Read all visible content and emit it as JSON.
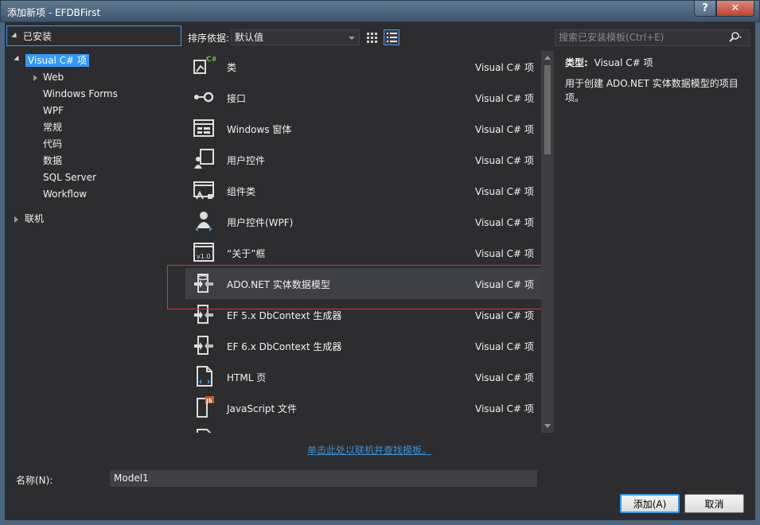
{
  "window": {
    "title": "添加新项 - EFDBFirst",
    "help_glyph": "?",
    "close_glyph": "✕"
  },
  "tree": {
    "header": "已安装",
    "items": [
      {
        "label": "Visual C# 项",
        "level": 0,
        "expanded": true,
        "selected": true
      },
      {
        "label": "Web",
        "level": 1,
        "collapsed": true
      },
      {
        "label": "Windows Forms",
        "level": 1
      },
      {
        "label": "WPF",
        "level": 1
      },
      {
        "label": "常规",
        "level": 1
      },
      {
        "label": "代码",
        "level": 1
      },
      {
        "label": "数据",
        "level": 1
      },
      {
        "label": "SQL Server",
        "level": 1
      },
      {
        "label": "Workflow",
        "level": 1
      }
    ],
    "online": "联机"
  },
  "toolbar": {
    "sort_label": "排序依据:",
    "sort_value": "默认值",
    "search_placeholder": "搜索已安装模板(Ctrl+E)"
  },
  "templates": [
    {
      "name": "类",
      "category": "Visual C# 项",
      "icon": "class-icon"
    },
    {
      "name": "接口",
      "category": "Visual C# 项",
      "icon": "interface-icon"
    },
    {
      "name": "Windows 窗体",
      "category": "Visual C# 项",
      "icon": "windows-form-icon"
    },
    {
      "name": "用户控件",
      "category": "Visual C# 项",
      "icon": "user-control-icon"
    },
    {
      "name": "组件类",
      "category": "Visual C# 项",
      "icon": "component-class-icon"
    },
    {
      "name": "用户控件(WPF)",
      "category": "Visual C# 项",
      "icon": "wpf-user-control-icon"
    },
    {
      "name": "“关于”框",
      "category": "Visual C# 项",
      "icon": "about-box-icon"
    },
    {
      "name": "ADO.NET 实体数据模型",
      "category": "Visual C# 项",
      "icon": "entity-model-icon",
      "selected": true
    },
    {
      "name": "EF 5.x DbContext 生成器",
      "category": "Visual C# 项",
      "icon": "ef-generator-icon"
    },
    {
      "name": "EF 6.x DbContext 生成器",
      "category": "Visual C# 项",
      "icon": "ef-generator-icon"
    },
    {
      "name": "HTML 页",
      "category": "Visual C# 项",
      "icon": "html-page-icon"
    },
    {
      "name": "JavaScript 文件",
      "category": "Visual C# 项",
      "icon": "javascript-file-icon"
    }
  ],
  "detail": {
    "type_label": "类型:",
    "type_value": "Visual C# 项",
    "description": "用于创建 ADO.NET 实体数据模型的项目项。"
  },
  "online_link": "单击此处以联机并查找模板。",
  "name_field": {
    "label": "名称(N):",
    "value": "Model1"
  },
  "buttons": {
    "add": "添加(A)",
    "cancel": "取消"
  },
  "colors": {
    "accent": "#3399ff",
    "highlight": "#e0312c",
    "link": "#3e8ed0"
  }
}
